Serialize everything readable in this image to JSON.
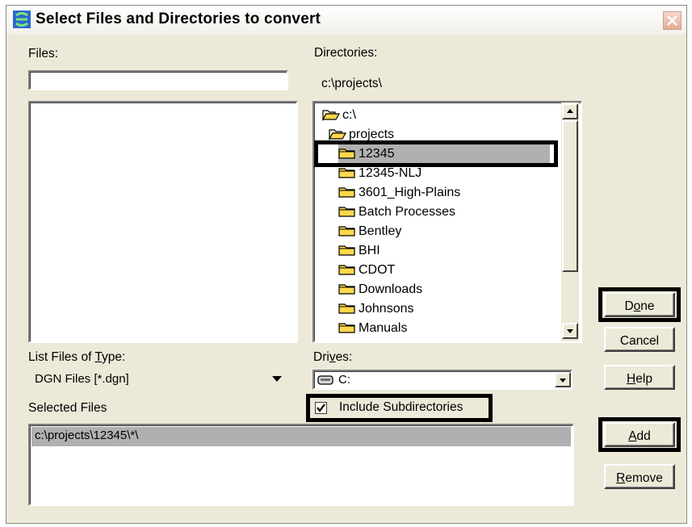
{
  "window": {
    "title": "Select Files and Directories to convert"
  },
  "files": {
    "label": "Files:",
    "value": ""
  },
  "directories": {
    "label": "Directories:",
    "current_path": "c:\\projects\\",
    "items": [
      {
        "label": "c:\\",
        "level": 0,
        "icon": "open-folder-icon"
      },
      {
        "label": "projects",
        "level": 1,
        "icon": "open-folder-icon"
      },
      {
        "label": "12345",
        "level": 2,
        "icon": "folder-icon",
        "selected": true
      },
      {
        "label": "12345-NLJ",
        "level": 2,
        "icon": "folder-icon"
      },
      {
        "label": "3601_High-Plains",
        "level": 2,
        "icon": "folder-icon"
      },
      {
        "label": "Batch Processes",
        "level": 2,
        "icon": "folder-icon"
      },
      {
        "label": "Bentley",
        "level": 2,
        "icon": "folder-icon"
      },
      {
        "label": "BHI",
        "level": 2,
        "icon": "folder-icon"
      },
      {
        "label": "CDOT",
        "level": 2,
        "icon": "folder-icon"
      },
      {
        "label": "Downloads",
        "level": 2,
        "icon": "folder-icon"
      },
      {
        "label": "Johnsons",
        "level": 2,
        "icon": "folder-icon"
      },
      {
        "label": "Manuals",
        "level": 2,
        "icon": "folder-icon"
      }
    ]
  },
  "file_type": {
    "label_pre": "List Files of ",
    "label_key": "T",
    "label_post": "ype:",
    "value": "DGN Files [*.dgn]"
  },
  "drives": {
    "label_pre": "Dri",
    "label_key": "v",
    "label_post": "es:",
    "value": "C:"
  },
  "selected_files": {
    "label": "Selected Files",
    "items": [
      "c:\\projects\\12345\\*\\"
    ]
  },
  "include_subdirectories": {
    "label": "Include Subdirectories",
    "checked": true
  },
  "buttons": {
    "done": {
      "pre": "D",
      "key": "o",
      "post": "ne"
    },
    "cancel": {
      "label": "Cancel"
    },
    "help": {
      "pre": "",
      "key": "H",
      "post": "elp"
    },
    "add": {
      "pre": "",
      "key": "A",
      "post": "dd"
    },
    "remove": {
      "pre": "",
      "key": "R",
      "post": "emove"
    }
  },
  "colors": {
    "highlight_border": "#000000",
    "folder_fill": "#ffd84a",
    "dialog_bg": "#ece9d8"
  }
}
